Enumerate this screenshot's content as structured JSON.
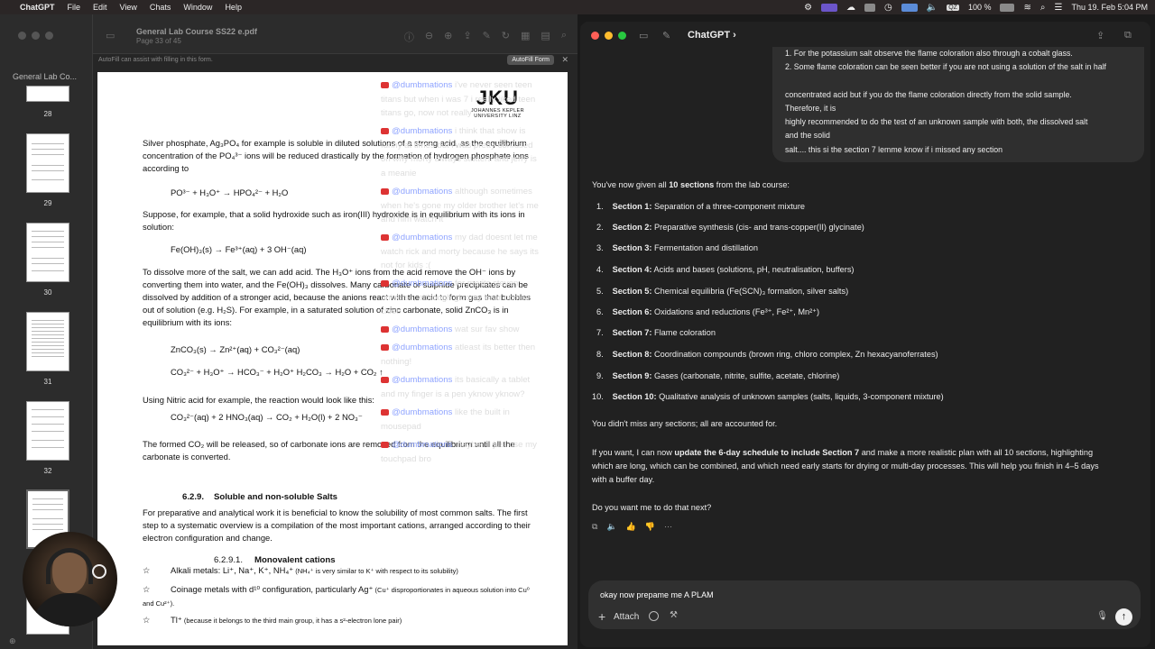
{
  "menubar": {
    "apple": "",
    "app": "ChatGPT",
    "items": [
      "File",
      "Edit",
      "View",
      "Chats",
      "Window",
      "Help"
    ],
    "battery": "100 %",
    "datetime": "Thu 19. Feb  5:04 PM",
    "qz": "QZ"
  },
  "pdf": {
    "title": "General Lab Course SS22 e.pdf",
    "subtitle": "Page 33 of 45",
    "sidebar_title": "General Lab Co...",
    "thumbnails": [
      "28",
      "29",
      "30",
      "31",
      "32"
    ],
    "autofill_text": "AutoFill can assist with filling in this form.",
    "autofill_button": "AutoFill Form",
    "logo_main": "JKU",
    "logo_line1": "JOHANNES KEPLER",
    "logo_line2": "UNIVERSITY LINZ",
    "p1": "Silver phosphate, Ag₃PO₄ for example is soluble in diluted solutions of a strong acid, as the equilibrium concentration of the PO₄³⁻ ions will be reduced drastically by the formation of hydrogen phosphate ions according to",
    "eq1": "PO³⁻ + H₃O⁺  →  HPO₄²⁻ + H₂O",
    "p2": "Suppose, for example, that a solid hydroxide such as iron(III) hydroxide is in equilibrium with its ions in solution:",
    "eq2": "Fe(OH)₃(s) →   Fe³⁺(aq) + 3 OH⁻(aq)",
    "p3": "To dissolve more of the salt, we can add acid. The H₃O⁺ ions from the acid remove the OH⁻ ions by converting them into water, and the Fe(OH)₃ dissolves. Many carbonate or sulphide precipitates can be dissolved by addition of a stronger acid, because the anions react with the acid to form gas that bubbles out of solution (e.g. H₂S). For example, in a saturated solution of zinc carbonate, solid ZnCO₃ is in equilibrium with its ions:",
    "eq3": "ZnCO₃(s) →  Zn²⁺(aq)  +  CO₃²⁻(aq)",
    "eq4": "CO₃²⁻ + H₃O⁺ → HCO₃⁻ + H₂O⁺          H₂CO₃ → H₂O + CO₂ ↑",
    "p4": "Using Nitric acid for example, the reaction would look like this:",
    "eq5": "CO₃²⁻(aq)  +  2 HNO₃(aq)  →  CO₂  +  H₂O(l)  +  2 NO₃⁻",
    "p5": "The formed CO₂ will be released, so of carbonate ions are removed from the equilibrium until all the carbonate is converted.",
    "h1_num": "6.2.9.",
    "h1": "Soluble and non-soluble Salts",
    "p6": "For preparative and analytical work it is beneficial to know the solubility of most common salts. The first step to a systematic overview is a compilation of the most important cations, arranged according to their electron configuration and change.",
    "h2_num": "6.2.9.1.",
    "h2": "Monovalent cations",
    "b1_main": "Alkali metals: Li⁺, Na⁺, K⁺, NH₄⁺",
    "b1_small": " (NH₄⁺ is very similar to K⁺ with respect to its solubility)",
    "b2_main": "Coinage metals with d¹⁰ configuration, particularly Ag⁺",
    "b2_small": " (Cu⁺ disproportionates in aqueous solution into Cu⁰ and Cu²⁺).",
    "b3_main": "Tl⁺",
    "b3_small": " (because it belongs to the third main group, it has a s²-electron lone pair)"
  },
  "chat": {
    "title": "ChatGPT ›",
    "user_lines": [
      "1. For the potassium salt observe the flame coloration also through a cobalt glass.",
      "2. Some flame coloration can be seen better if you are not using a solution of the salt in half",
      "concentrated acid but if you do the flame coloration directly from the solid sample.",
      "Therefore, it is",
      "highly recommended to do the test of an unknown sample with both, the dissolved salt",
      "and the solid",
      "salt.... this si the section 7 lemme know if i missed any section"
    ],
    "intro_pre": "You've now given all ",
    "intro_bold": "10 sections",
    "intro_post": " from the lab course:",
    "sections": [
      {
        "n": "1.",
        "label": "Section 1:",
        "text": " Separation of a three-component mixture"
      },
      {
        "n": "2.",
        "label": "Section 2:",
        "text": " Preparative synthesis (cis- and trans-copper(II) glycinate)"
      },
      {
        "n": "3.",
        "label": "Section 3:",
        "text": " Fermentation and distillation"
      },
      {
        "n": "4.",
        "label": "Section 4:",
        "text": " Acids and bases (solutions, pH, neutralisation, buffers)"
      },
      {
        "n": "5.",
        "label": "Section 5:",
        "text": " Chemical equilibria (Fe(SCN)₃ formation, silver salts)"
      },
      {
        "n": "6.",
        "label": "Section 6:",
        "text": " Oxidations and reductions (Fe³⁺, Fe²⁺, Mn²⁺)"
      },
      {
        "n": "7.",
        "label": "Section 7:",
        "text": " Flame coloration"
      },
      {
        "n": "8.",
        "label": "Section 8:",
        "text": " Coordination compounds (brown ring, chloro complex, Zn hexacyanoferrates)"
      },
      {
        "n": "9.",
        "label": "Section 9:",
        "text": " Gases (carbonate, nitrite, sulfite, acetate, chlorine)"
      },
      {
        "n": "10.",
        "label": "Section 10:",
        "text": " Qualitative analysis of unknown samples (salts, liquids, 3-component mixture)"
      }
    ],
    "no_missing": "You didn't miss any sections; all are accounted for.",
    "offer_pre": "If you want, I can now ",
    "offer_bold": "update the 6-day schedule to include Section 7",
    "offer_mid": " and make a more realistic plan with all 10 sections, highlighting",
    "offer_line2": "which are long, which can be combined, and which need early starts for drying or multi-day processes. This will help you finish in 4–5 days",
    "offer_line3": "with a buffer day.",
    "question": "Do you want me to do that next?",
    "composer_text": "okay now prepame me A PLAM",
    "attach": "Attach"
  },
  "overlay_comments": [
    {
      "user": "@dumbmations",
      "lines": [
        "i've never seen teen",
        "titans but when i was 7 i really liked teen",
        "titans go, now not really"
      ]
    },
    {
      "user": "@dumbmations",
      "lines": [
        "i think that show is",
        "funny at times but i was pretty confused",
        "on why morty always stutters and jerry is",
        "a meanie"
      ]
    },
    {
      "user": "@dumbmations",
      "lines": [
        "although sometimes",
        "when he's gone my older brother let's me",
        "and him watch it"
      ]
    },
    {
      "user": "@dumbmations",
      "lines": [
        "my dad doesnt let me",
        "watch rick and morty because he says its",
        "not for kids :("
      ]
    },
    {
      "user": "@dumbmations",
      "lines": [
        "for me its steven",
        "universe, although gloomy bear comes",
        "close"
      ]
    },
    {
      "user": "@dumbmations",
      "lines": [
        "wat sur fav show"
      ]
    },
    {
      "user": "@dumbmations",
      "lines": [
        "atleast its better then",
        "nothing!"
      ]
    },
    {
      "user": "@dumbmations",
      "lines": [
        "its basically a tablet",
        "and my finger is a pen yknow yknow?"
      ]
    },
    {
      "user": "@dumbmations",
      "lines": [
        "like the built in",
        "mousepad"
      ]
    },
    {
      "user": "@dumbmations",
      "lines": [
        "maybe i'll just use my",
        "touchpad bro"
      ]
    }
  ],
  "colors": {
    "accent": "#8fa4ff",
    "send": "#f0f0f0",
    "red": "#ff5f57",
    "yellow": "#febc2e",
    "green": "#28c840"
  }
}
